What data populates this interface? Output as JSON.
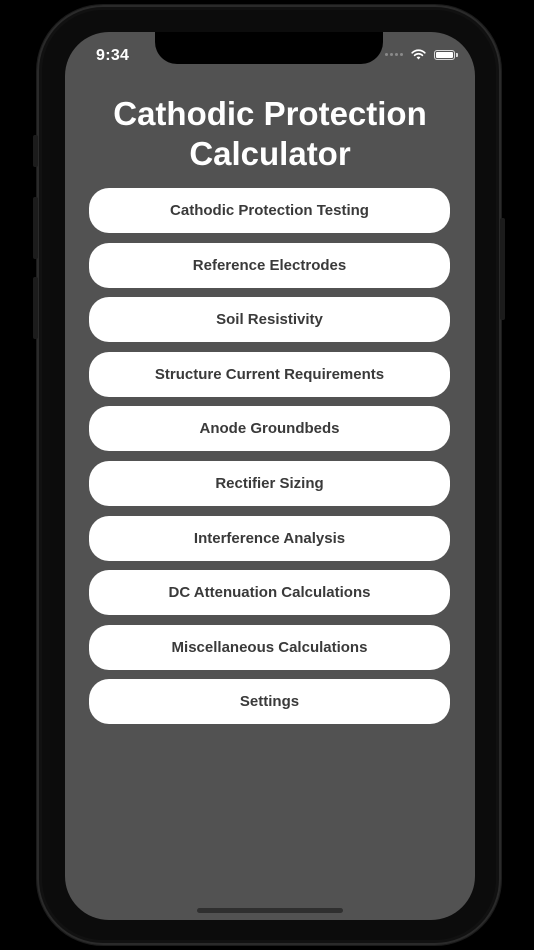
{
  "status_bar": {
    "time": "9:34",
    "icons": [
      "signal-dots-icon",
      "wifi-icon",
      "battery-icon"
    ]
  },
  "title_line1": "Cathodic Protection",
  "title_line2": "Calculator",
  "menu": {
    "items": [
      {
        "label": "Cathodic Protection Testing"
      },
      {
        "label": "Reference Electrodes"
      },
      {
        "label": "Soil Resistivity"
      },
      {
        "label": "Structure Current Requirements"
      },
      {
        "label": "Anode Groundbeds"
      },
      {
        "label": "Rectifier Sizing"
      },
      {
        "label": "Interference Analysis"
      },
      {
        "label": "DC Attenuation Calculations"
      },
      {
        "label": "Miscellaneous Calculations"
      },
      {
        "label": "Settings"
      }
    ]
  },
  "colors": {
    "background": "#000000",
    "screen": "#525252",
    "button": "#ffffff",
    "button_text": "#3a3a3a",
    "title_text": "#ffffff"
  }
}
